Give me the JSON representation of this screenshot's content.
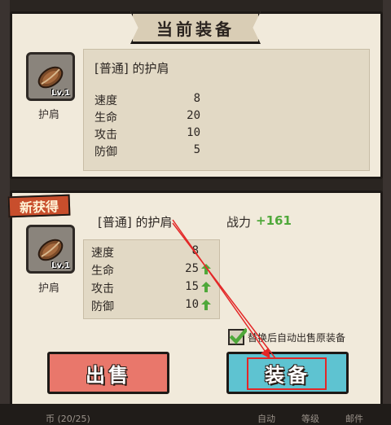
{
  "header": {
    "title": "当前装备"
  },
  "current": {
    "item_level": "Lv.1",
    "item_name": "护肩",
    "title_line": "[普通] 的护肩",
    "stats": [
      {
        "label": "速度",
        "value": "8"
      },
      {
        "label": "生命",
        "value": "20"
      },
      {
        "label": "攻击",
        "value": "10"
      },
      {
        "label": "防御",
        "value": "5"
      }
    ]
  },
  "new_item": {
    "tag": "新获得",
    "item_level": "Lv.1",
    "item_name": "护肩",
    "title_line": "[普通] 的护肩",
    "power_label": "战力",
    "power_value": "+161",
    "stats": [
      {
        "label": "速度",
        "value": "8",
        "up": false
      },
      {
        "label": "生命",
        "value": "25",
        "up": true
      },
      {
        "label": "攻击",
        "value": "15",
        "up": true
      },
      {
        "label": "防御",
        "value": "10",
        "up": true
      }
    ]
  },
  "auto_sell": {
    "checked": true,
    "label": "替换后自动出售原装备"
  },
  "buttons": {
    "sell": "出售",
    "equip": "装备"
  },
  "bottom_bar": {
    "left_text": "币 (20/25)",
    "items": [
      "自动",
      "等级",
      "邮件"
    ]
  },
  "colors": {
    "panel": "#f1eadb",
    "sell_button": "#e9776b",
    "equip_button": "#5ec3d1",
    "power_positive": "#4fa83a",
    "highlight": "#e32727"
  }
}
